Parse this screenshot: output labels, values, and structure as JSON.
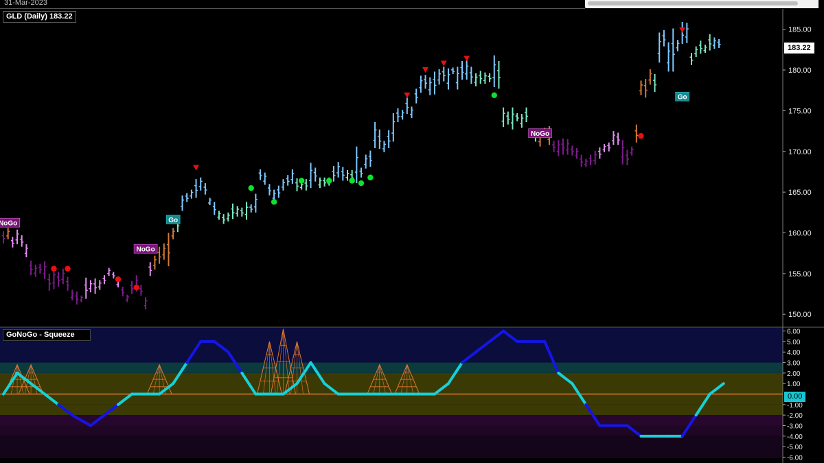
{
  "header": {
    "date_label": "31-Mar-2023"
  },
  "price_panel": {
    "symbol_label": "GLD (Daily) 183.22",
    "last_price_label": "183.22"
  },
  "osc_panel": {
    "label": "GoNoGo - Squeeze",
    "last_value_label": "0.00"
  },
  "colors": {
    "strong_go": "#2e9cff",
    "go": "#7ec8ff",
    "weak_go": "#7de8c2",
    "nogo": "#7d1c8c",
    "weak_nogo": "#e38cf2",
    "amber": "#d37a35",
    "osc_high": "#1515e6",
    "osc_low": "#17d0d8",
    "squeeze": "#e07830",
    "zero_line": "#e07830"
  },
  "chart_data": [
    {
      "type": "ohlc-bar",
      "ylim": [
        148.5,
        187.5
      ],
      "y_ticks": [
        "150.00",
        "155.00",
        "160.00",
        "165.00",
        "170.00",
        "175.00",
        "180.00",
        "185.00"
      ],
      "bars": [
        [
          160.2,
          158.7,
          "nogo"
        ],
        [
          160.6,
          159.2,
          "amber"
        ],
        [
          159.5,
          158.2,
          "weak_nogo"
        ],
        [
          160.4,
          158.6,
          "weak_nogo"
        ],
        [
          159.7,
          158.3,
          "weak_nogo"
        ],
        [
          158.6,
          157.0,
          "weak_nogo"
        ],
        [
          156.6,
          154.8,
          "nogo"
        ],
        [
          156.1,
          154.6,
          "nogo"
        ],
        [
          156.2,
          155.0,
          "nogo"
        ],
        [
          156.5,
          154.3,
          "nogo"
        ],
        [
          155.0,
          152.9,
          "nogo"
        ],
        [
          155.6,
          153.1,
          "nogo"
        ],
        [
          155.2,
          153.4,
          "nogo"
        ],
        [
          155.6,
          153.7,
          "nogo"
        ],
        [
          154.6,
          152.9,
          "nogo"
        ],
        [
          153.0,
          151.7,
          "nogo"
        ],
        [
          152.8,
          151.2,
          "nogo"
        ],
        [
          152.3,
          151.5,
          "nogo"
        ],
        [
          154.5,
          151.9,
          "weak_nogo"
        ],
        [
          154.2,
          152.7,
          "weak_nogo"
        ],
        [
          154.4,
          152.5,
          "weak_nogo"
        ],
        [
          154.2,
          153.0,
          "weak_nogo"
        ],
        [
          154.8,
          153.7,
          "weak_nogo"
        ],
        [
          155.7,
          154.7,
          "weak_nogo"
        ],
        [
          155.2,
          154.4,
          "weak_nogo"
        ],
        [
          154.5,
          153.3,
          "weak_nogo"
        ],
        [
          153.4,
          152.2,
          "nogo"
        ],
        [
          152.4,
          151.5,
          "nogo"
        ],
        [
          154.1,
          152.5,
          "nogo"
        ],
        [
          154.8,
          152.8,
          "nogo"
        ],
        [
          153.6,
          152.3,
          "nogo"
        ],
        [
          152.1,
          150.6,
          "nogo"
        ],
        [
          156.4,
          154.7,
          "weak_nogo"
        ],
        [
          157.2,
          155.5,
          "amber"
        ],
        [
          158.3,
          156.2,
          "amber"
        ],
        [
          158.7,
          156.7,
          "amber"
        ],
        [
          160.0,
          155.9,
          "amber"
        ],
        [
          160.6,
          159.2,
          "amber"
        ],
        [
          162.0,
          160.1,
          "weak_go"
        ],
        [
          164.6,
          162.7,
          "go"
        ],
        [
          164.9,
          163.8,
          "go"
        ],
        [
          165.3,
          164.2,
          "go"
        ],
        [
          166.6,
          164.3,
          "go"
        ],
        [
          166.8,
          165.2,
          "go"
        ],
        [
          166.1,
          164.7,
          "go"
        ],
        [
          164.3,
          163.4,
          "go"
        ],
        [
          163.8,
          162.2,
          "go"
        ],
        [
          162.7,
          161.6,
          "weak_go"
        ],
        [
          162.3,
          161.1,
          "weak_go"
        ],
        [
          162.5,
          161.4,
          "weak_go"
        ],
        [
          163.6,
          161.7,
          "weak_go"
        ],
        [
          163.3,
          162.0,
          "weak_go"
        ],
        [
          163.1,
          162.0,
          "weak_go"
        ],
        [
          163.8,
          161.6,
          "weak_go"
        ],
        [
          163.5,
          162.5,
          "go"
        ],
        [
          164.8,
          162.5,
          "go"
        ],
        [
          167.8,
          166.5,
          "go"
        ],
        [
          167.4,
          165.9,
          "go"
        ],
        [
          166.0,
          164.6,
          "go"
        ],
        [
          165.3,
          163.8,
          "go"
        ],
        [
          165.8,
          164.3,
          "go"
        ],
        [
          166.6,
          165.2,
          "go"
        ],
        [
          167.1,
          165.8,
          "go"
        ],
        [
          167.8,
          166.0,
          "go"
        ],
        [
          166.7,
          165.1,
          "weak_go"
        ],
        [
          166.2,
          165.3,
          "weak_go"
        ],
        [
          166.6,
          165.2,
          "weak_go"
        ],
        [
          168.6,
          165.5,
          "go"
        ],
        [
          168.0,
          166.3,
          "go"
        ],
        [
          166.8,
          165.5,
          "weak_go"
        ],
        [
          166.8,
          165.7,
          "weak_go"
        ],
        [
          166.8,
          165.8,
          "weak_go"
        ],
        [
          168.2,
          166.3,
          "go"
        ],
        [
          168.7,
          166.8,
          "go"
        ],
        [
          168.1,
          166.4,
          "go"
        ],
        [
          167.7,
          166.4,
          "weak_go"
        ],
        [
          167.7,
          166.1,
          "weak_go"
        ],
        [
          170.6,
          166.1,
          "go"
        ],
        [
          168.0,
          166.8,
          "go"
        ],
        [
          169.6,
          167.9,
          "go"
        ],
        [
          170.1,
          168.1,
          "go"
        ],
        [
          173.6,
          170.4,
          "go"
        ],
        [
          172.7,
          170.3,
          "go"
        ],
        [
          171.3,
          169.9,
          "go"
        ],
        [
          172.6,
          170.4,
          "go"
        ],
        [
          174.7,
          171.2,
          "go"
        ],
        [
          175.3,
          173.6,
          "go"
        ],
        [
          175.1,
          173.9,
          "go"
        ],
        [
          176.6,
          174.6,
          "go"
        ],
        [
          175.5,
          174.1,
          "go"
        ],
        [
          177.7,
          175.9,
          "go"
        ],
        [
          179.3,
          177.2,
          "go"
        ],
        [
          179.4,
          177.7,
          "go"
        ],
        [
          179.1,
          176.9,
          "go"
        ],
        [
          179.8,
          177.0,
          "go"
        ],
        [
          180.1,
          178.2,
          "go"
        ],
        [
          180.4,
          178.6,
          "go"
        ],
        [
          180.2,
          177.6,
          "go"
        ],
        [
          180.3,
          179.5,
          "go"
        ],
        [
          180.4,
          177.6,
          "go"
        ],
        [
          181.1,
          178.8,
          "go"
        ],
        [
          181.2,
          178.8,
          "go"
        ],
        [
          180.4,
          178.3,
          "go"
        ],
        [
          179.6,
          178.0,
          "weak_go"
        ],
        [
          179.9,
          178.3,
          "weak_go"
        ],
        [
          179.7,
          178.3,
          "weak_go"
        ],
        [
          179.6,
          178.5,
          "weak_go"
        ],
        [
          181.8,
          177.9,
          "go"
        ],
        [
          181.1,
          177.7,
          "weak_go"
        ],
        [
          175.4,
          173.0,
          "weak_go"
        ],
        [
          174.9,
          173.3,
          "weak_go"
        ],
        [
          175.4,
          172.7,
          "weak_go"
        ],
        [
          174.7,
          173.7,
          "weak_go"
        ],
        [
          174.6,
          172.9,
          "weak_go"
        ],
        [
          175.4,
          173.6,
          "weak_go"
        ],
        [
          172.7,
          171.9,
          "weak_go"
        ],
        [
          172.7,
          171.2,
          "weak_go"
        ],
        [
          172.6,
          170.6,
          "amber"
        ],
        [
          172.9,
          171.8,
          "amber"
        ],
        [
          173.1,
          170.8,
          "amber"
        ],
        [
          171.3,
          169.9,
          "nogo"
        ],
        [
          171.4,
          169.4,
          "nogo"
        ],
        [
          171.6,
          169.6,
          "nogo"
        ],
        [
          171.5,
          169.6,
          "nogo"
        ],
        [
          170.7,
          169.5,
          "nogo"
        ],
        [
          170.4,
          169.1,
          "nogo"
        ],
        [
          169.6,
          168.1,
          "nogo"
        ],
        [
          169.1,
          168.1,
          "nogo"
        ],
        [
          169.6,
          168.3,
          "nogo"
        ],
        [
          170.1,
          168.4,
          "nogo"
        ],
        [
          170.5,
          169.1,
          "weak_nogo"
        ],
        [
          170.9,
          169.9,
          "weak_nogo"
        ],
        [
          171.1,
          170.0,
          "weak_nogo"
        ],
        [
          172.5,
          170.8,
          "weak_nogo"
        ],
        [
          172.3,
          170.8,
          "weak_nogo"
        ],
        [
          171.4,
          168.4,
          "nogo"
        ],
        [
          170.2,
          168.3,
          "nogo"
        ],
        [
          170.6,
          169.5,
          "nogo"
        ],
        [
          173.3,
          171.1,
          "amber"
        ],
        [
          178.7,
          176.9,
          "amber"
        ],
        [
          178.9,
          176.6,
          "amber"
        ],
        [
          180.1,
          178.2,
          "amber"
        ],
        [
          179.5,
          177.3,
          "weak_go"
        ],
        [
          184.6,
          180.9,
          "go"
        ],
        [
          184.9,
          182.9,
          "go"
        ],
        [
          183.4,
          179.8,
          "go"
        ],
        [
          185.1,
          179.8,
          "go"
        ],
        [
          183.7,
          182.3,
          "go"
        ],
        [
          185.9,
          183.2,
          "go"
        ],
        [
          185.8,
          183.3,
          "go"
        ],
        [
          182.1,
          180.6,
          "weak_go"
        ],
        [
          182.9,
          181.6,
          "weak_go"
        ],
        [
          183.6,
          182.0,
          "weak_go"
        ],
        [
          183.1,
          182.1,
          "weak_go"
        ],
        [
          184.4,
          182.4,
          "weak_go"
        ],
        [
          184.0,
          182.6,
          "go"
        ],
        [
          183.8,
          182.7,
          "go"
        ]
      ],
      "go_labels": [
        {
          "text": "NoGo",
          "bar": 1,
          "y": 161.2,
          "kind": "nogo"
        },
        {
          "text": "Go",
          "bar": 37,
          "y": 161.6,
          "kind": "go"
        },
        {
          "text": "NoGo",
          "bar": 31,
          "y": 158.0,
          "kind": "nogo"
        },
        {
          "text": "NoGo",
          "bar": 117,
          "y": 172.2,
          "kind": "nogo"
        },
        {
          "text": "Go",
          "bar": 148,
          "y": 176.7,
          "kind": "go"
        }
      ],
      "countertrend_markers": [
        {
          "bar": 42,
          "y": 168.0
        },
        {
          "bar": 88,
          "y": 176.9
        },
        {
          "bar": 92,
          "y": 180.0
        },
        {
          "bar": 96,
          "y": 180.8
        },
        {
          "bar": 101,
          "y": 181.4
        },
        {
          "bar": 148,
          "y": 184.9
        }
      ],
      "continuation_dots": [
        {
          "bar": 54,
          "y": 165.5,
          "kind": "go"
        },
        {
          "bar": 59,
          "y": 163.8,
          "kind": "go"
        },
        {
          "bar": 65,
          "y": 166.4,
          "kind": "go"
        },
        {
          "bar": 71,
          "y": 166.4,
          "kind": "go"
        },
        {
          "bar": 76,
          "y": 166.4,
          "kind": "go"
        },
        {
          "bar": 78,
          "y": 166.1,
          "kind": "go"
        },
        {
          "bar": 80,
          "y": 166.8,
          "kind": "go"
        },
        {
          "bar": 107,
          "y": 176.9,
          "kind": "go"
        },
        {
          "bar": 11,
          "y": 155.6,
          "kind": "nogo"
        },
        {
          "bar": 14,
          "y": 155.6,
          "kind": "nogo"
        },
        {
          "bar": 25,
          "y": 154.3,
          "kind": "nogo"
        },
        {
          "bar": 29,
          "y": 153.3,
          "kind": "nogo"
        },
        {
          "bar": 139,
          "y": 171.9,
          "kind": "nogo"
        }
      ]
    },
    {
      "type": "line",
      "title": "GoNoGo - Squeeze",
      "ylim": [
        -6.1,
        6.3
      ],
      "y_ticks": [
        "6.00",
        "5.00",
        "4.00",
        "3.00",
        "2.00",
        "1.00",
        "0.00",
        "-1.00",
        "-2.00",
        "-3.00",
        "-4.00",
        "-5.00",
        "-6.00"
      ],
      "x": [
        0,
        3,
        6,
        9,
        12,
        15,
        19,
        22,
        25,
        28,
        31,
        34,
        37,
        40,
        43,
        46,
        49,
        52,
        55,
        58,
        61,
        64,
        67,
        70,
        73,
        76,
        79,
        82,
        85,
        88,
        91,
        94,
        97,
        100,
        103,
        106,
        109,
        112,
        115,
        118,
        121,
        124,
        127,
        130,
        133,
        136,
        139,
        142,
        145,
        148,
        151,
        154,
        157
      ],
      "values": [
        0,
        2,
        1,
        0,
        -1,
        -2,
        -3,
        -2,
        -1,
        0,
        0,
        0,
        1,
        3,
        5,
        5,
        4,
        2,
        0,
        0,
        0,
        1,
        3,
        1,
        0,
        0,
        0,
        0,
        0,
        0,
        0,
        0,
        1,
        3,
        4,
        5,
        6,
        5,
        5,
        5,
        2,
        1,
        -1,
        -3,
        -3,
        -3,
        -4,
        -4,
        -4,
        -4,
        -2,
        0,
        1
      ],
      "squeeze": [
        0,
        1,
        1,
        0,
        0,
        0,
        0,
        0,
        0,
        0,
        0,
        1,
        0,
        0,
        0,
        0,
        0,
        0,
        0,
        2,
        3,
        2,
        0,
        0,
        0,
        0,
        0,
        1,
        0,
        1,
        0,
        0,
        0,
        0,
        0,
        0,
        0,
        0,
        0,
        0,
        0,
        0,
        0,
        0,
        0,
        0,
        0,
        0,
        0,
        0,
        0,
        0,
        0
      ]
    }
  ]
}
